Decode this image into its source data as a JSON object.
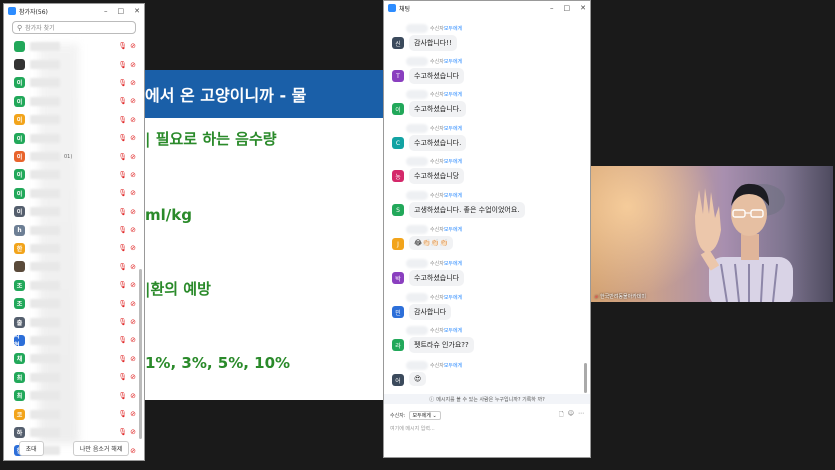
{
  "participants": {
    "title": "참가자(56)",
    "search_placeholder": "참가자 찾기",
    "extra_text": "01)",
    "rows": [
      {
        "initial": "",
        "color": "#22a85a"
      },
      {
        "initial": "",
        "color": "#333333"
      },
      {
        "initial": "이",
        "color": "#22a85a"
      },
      {
        "initial": "이",
        "color": "#22a85a"
      },
      {
        "initial": "이",
        "color": "#f2a41b"
      },
      {
        "initial": "이",
        "color": "#22a85a"
      },
      {
        "initial": "이",
        "color": "#e8642c"
      },
      {
        "initial": "이",
        "color": "#22a85a"
      },
      {
        "initial": "이",
        "color": "#22a85a"
      },
      {
        "initial": "이",
        "color": "#555f6e"
      },
      {
        "initial": "h",
        "color": "#6d7f95"
      },
      {
        "initial": "한",
        "color": "#f2a41b"
      },
      {
        "initial": "",
        "color": "#5a4a3a"
      },
      {
        "initial": "조",
        "color": "#22a85a"
      },
      {
        "initial": "조",
        "color": "#22a85a"
      },
      {
        "initial": "출",
        "color": "#555f6e"
      },
      {
        "initial": "지현",
        "color": "#2d6fd9"
      },
      {
        "initial": "채",
        "color": "#22a85a"
      },
      {
        "initial": "최",
        "color": "#22a85a"
      },
      {
        "initial": "최",
        "color": "#22a85a"
      },
      {
        "initial": "코",
        "color": "#f2a41b"
      },
      {
        "initial": "하",
        "color": "#555f6e"
      },
      {
        "initial": "한",
        "color": "#2d6fd9"
      }
    ],
    "invite_label": "초대",
    "unmute_label": "나만 음소거 해제"
  },
  "slide": {
    "title": "에서 온 고양이니까 - 물",
    "line1": "| 필요로 하는 음수량",
    "line2": "ml/kg",
    "line3": "|환의 예방",
    "line4": "1%, 3%, 5%, 10%"
  },
  "chat": {
    "title": "채팅",
    "to_label": "수신자",
    "to_target": "모두에게",
    "messages": [
      {
        "initial": "신",
        "color": "#3b4a5c",
        "text": "감사합니다!!"
      },
      {
        "initial": "T",
        "color": "#8a3fbf",
        "text": "수고하셨습니다"
      },
      {
        "initial": "이",
        "color": "#22a85a",
        "text": "수고하셨습니다."
      },
      {
        "initial": "C",
        "color": "#12a3a3",
        "text": "수고하셨습니다."
      },
      {
        "initial": "농",
        "color": "#d4286a",
        "text": "수고하셨습니당"
      },
      {
        "initial": "S",
        "color": "#22a85a",
        "text": "고생하셨습니다. 좋은 수업이었어요."
      },
      {
        "initial": "J",
        "color": "#f2a41b",
        "text": "😂👏🏻👏🏻👏🏻"
      },
      {
        "initial": "박",
        "color": "#8a3fbf",
        "text": "수고하셨습니다"
      },
      {
        "initial": "민",
        "color": "#2d6fd9",
        "text": "감사합니다"
      },
      {
        "initial": "라",
        "color": "#22a85a",
        "text": "펫트라슈 인가요??"
      },
      {
        "initial": "어",
        "color": "#3b4a5c",
        "text": "😍"
      }
    ],
    "notice": "메시지를 볼 수 있는 사람은 누구입니까? 기록하 까?",
    "recipient_label": "수신자:",
    "recipient_value": "모두에게 ⌄",
    "input_placeholder": "여기에 메시지 입력..."
  },
  "video": {
    "name_label": "한국반려동물아카데미"
  },
  "colors": {
    "slide_band": "#1a5fa8",
    "slide_text": "#2a8a2a",
    "mute_icon": "#e02828",
    "zoom_blue": "#2d8cff"
  }
}
